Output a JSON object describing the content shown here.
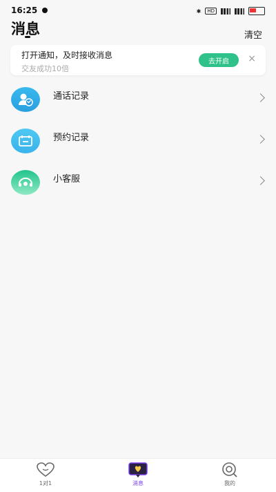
{
  "status": {
    "time": "16:25",
    "icons": [
      "bluetooth-icon",
      "hd-icon",
      "signal-icon",
      "battery-icon"
    ]
  },
  "header": {
    "title": "消息",
    "clear_label": "清空"
  },
  "notify": {
    "title": "打开通知，及时接收消息",
    "subtitle": "交友成功10倍",
    "open_label": "去开启",
    "close_label": "×"
  },
  "list": [
    {
      "label": "通话记录",
      "icon": "phone-record-icon"
    },
    {
      "label": "预约记录",
      "icon": "calendar-icon"
    },
    {
      "label": "小客服",
      "icon": "customer-service-icon"
    }
  ],
  "nav": [
    {
      "label": "1对1",
      "icon": "heart-icon",
      "active": false
    },
    {
      "label": "消息",
      "icon": "message-icon",
      "active": true
    },
    {
      "label": "我的",
      "icon": "profile-icon",
      "active": false
    }
  ],
  "colors": {
    "accent": "#2ec28a",
    "active_nav": "#7a3cf0",
    "icon_blue": "#39b9ee"
  }
}
